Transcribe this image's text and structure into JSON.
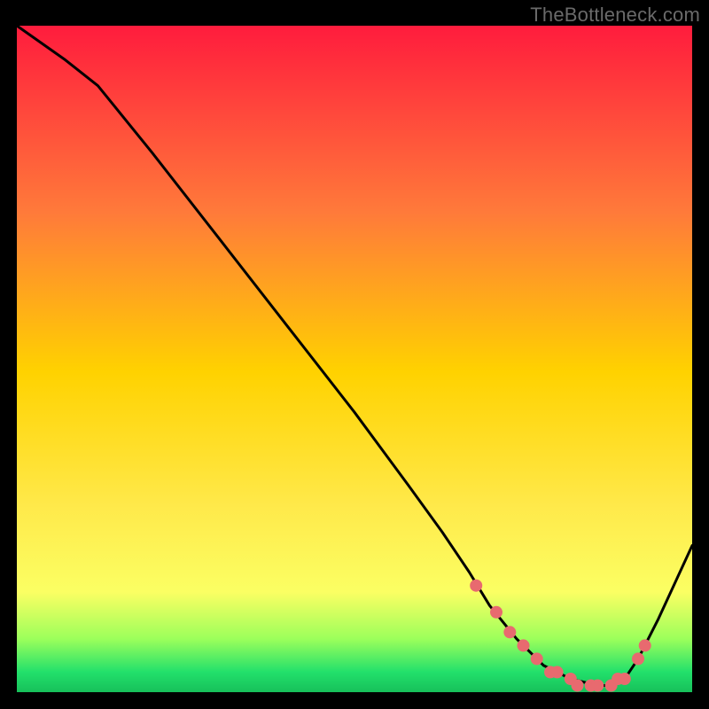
{
  "watermark": "TheBottleneck.com",
  "colors": {
    "gradient_top": "#ff1c3d",
    "gradient_mid_upper": "#ff7a3a",
    "gradient_mid": "#ffd200",
    "gradient_mid_lower": "#ffe94a",
    "gradient_low_yellow": "#fbff63",
    "gradient_green_light": "#9cff5b",
    "gradient_green": "#22e06b",
    "gradient_green_deep": "#17c05a",
    "line": "#000000",
    "marker": "#e86a6f"
  },
  "chart_data": {
    "type": "line",
    "title": "",
    "xlabel": "",
    "ylabel": "",
    "xlim": [
      0,
      100
    ],
    "ylim": [
      0,
      100
    ],
    "series": [
      {
        "name": "bottleneck-curve",
        "x": [
          0,
          7,
          12,
          20,
          30,
          40,
          50,
          58,
          63,
          67,
          70,
          74,
          78,
          82,
          86,
          88,
          90,
          92,
          95,
          100
        ],
        "y": [
          100,
          95,
          91,
          81,
          68,
          55,
          42,
          31,
          24,
          18,
          13,
          8,
          4,
          2,
          1,
          1,
          2,
          5,
          11,
          22
        ]
      }
    ],
    "markers": {
      "name": "highlight-points",
      "x": [
        68,
        71,
        73,
        75,
        77,
        79,
        80,
        82,
        83,
        85,
        86,
        88,
        89,
        90,
        92,
        93
      ],
      "y": [
        16,
        12,
        9,
        7,
        5,
        3,
        3,
        2,
        1,
        1,
        1,
        1,
        2,
        2,
        5,
        7
      ]
    }
  }
}
